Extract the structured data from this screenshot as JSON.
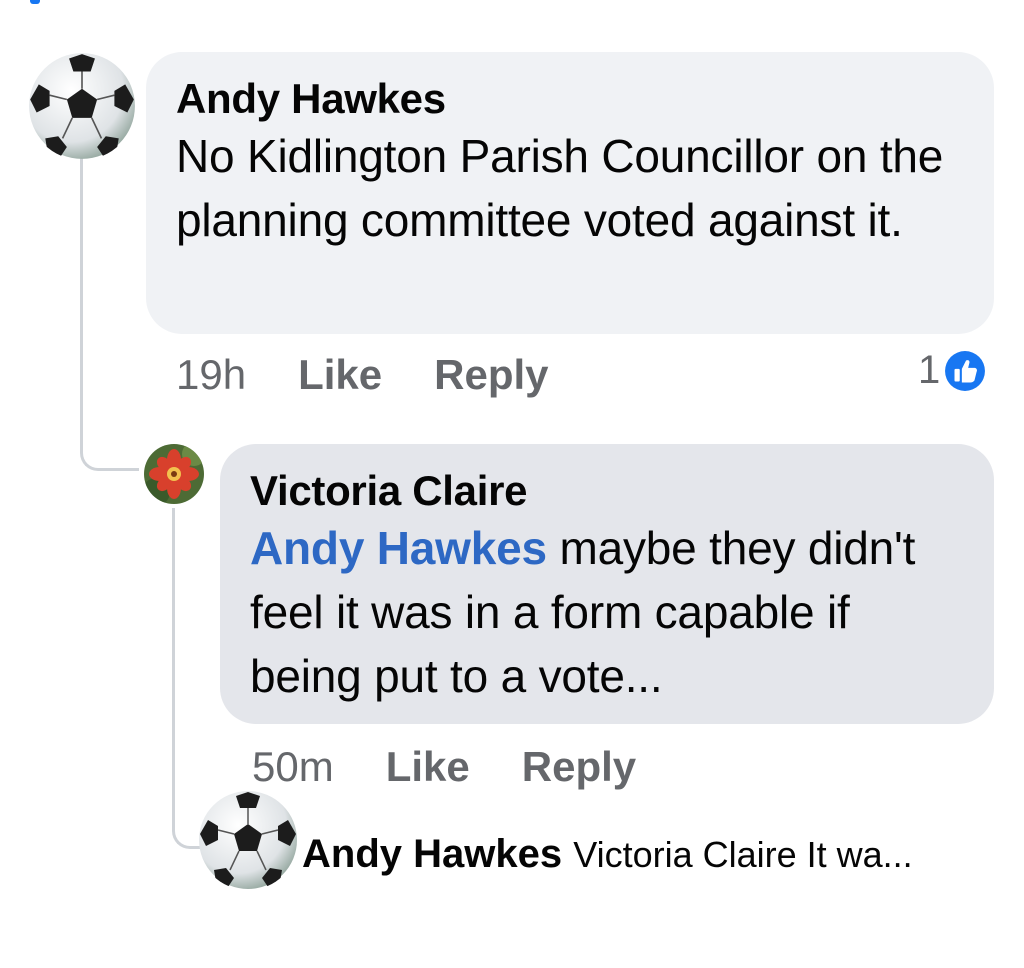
{
  "comments": [
    {
      "author": "Andy Hawkes",
      "text": "No Kidlington Parish Councillor on the planning committee voted against it.",
      "time": "19h",
      "like_label": "Like",
      "reply_label": "Reply",
      "reaction_count": "1",
      "reaction_type": "like-icon",
      "avatar": "soccer-ball-icon"
    },
    {
      "author": "Victoria Claire",
      "mention": "Andy Hawkes",
      "text": " maybe they didn't feel it was in a form capable if being put to a vote...",
      "time": "50m",
      "like_label": "Like",
      "reply_label": "Reply",
      "avatar": "red-flower-icon"
    }
  ],
  "reply_preview": {
    "author": "Andy Hawkes",
    "text": "Victoria Claire It wa...",
    "avatar": "soccer-ball-icon"
  },
  "colors": {
    "bubble_primary": "#f0f2f5",
    "bubble_secondary": "#e4e6eb",
    "mention": "#2d68c4",
    "meta_text": "#65676b",
    "like_blue": "#1877f2"
  }
}
